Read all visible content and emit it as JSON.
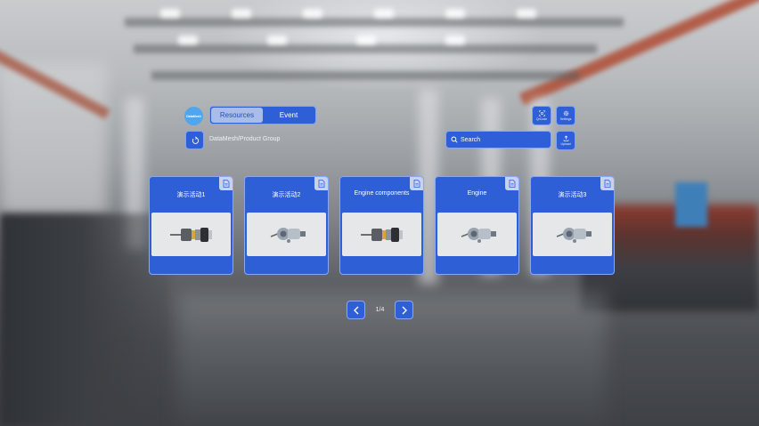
{
  "header": {
    "logo_text": "DataMesh",
    "tabs": [
      {
        "label": "Resources",
        "active": true
      },
      {
        "label": "Event",
        "active": false
      }
    ],
    "breadcrumb": "DataMesh/Product Group",
    "search_placeholder": "Search",
    "qr_label": "QrCode",
    "settings_label": "Settings",
    "upload_label": "Upload"
  },
  "cards": [
    {
      "title": "演示活动1",
      "thumbnail": "engine-component-icon"
    },
    {
      "title": "演示活动2",
      "thumbnail": "engine-icon"
    },
    {
      "title": "Engine components",
      "thumbnail": "engine-component-icon"
    },
    {
      "title": "Engine",
      "thumbnail": "engine-icon"
    },
    {
      "title": "演示活动3",
      "thumbnail": "engine-icon"
    }
  ],
  "pagination": {
    "text": "1/4"
  },
  "colors": {
    "accent": "#2f5fd6",
    "active_tab": "#a9bde8",
    "logo": "#4fa6ef"
  }
}
